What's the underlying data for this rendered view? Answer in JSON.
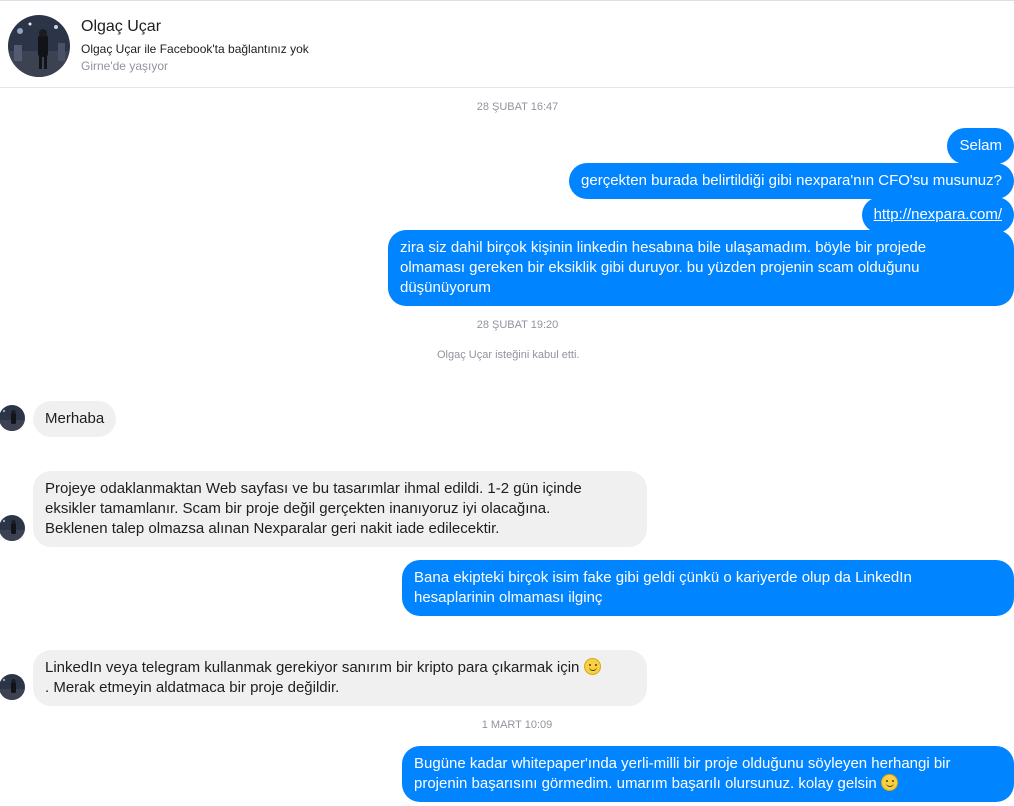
{
  "contact": {
    "name": "Olgaç Uçar",
    "connection": "Olgaç Uçar ile Facebook'ta bağlantınız yok",
    "location": "Girne'de yaşıyor"
  },
  "thread": {
    "stamp1": "28 ŞUBAT 16:47",
    "stamp2": "28 ŞUBAT 19:20",
    "stamp3": "1 MART 10:09",
    "system_accept": "Olgaç Uçar isteğini kabul etti.",
    "messages": [
      {
        "from": "me",
        "text": "Selam"
      },
      {
        "from": "me",
        "text": "gerçekten burada belirtildiği gibi nexpara'nın CFO'su musunuz?"
      },
      {
        "from": "me",
        "text": "http://nexpara.com/",
        "type": "link"
      },
      {
        "from": "me",
        "lines": [
          "zira siz dahil birçok kişinin linkedin hesabına bile ulaşamadım. böyle bir projede",
          "olmaması gereken bir eksiklik gibi duruyor. bu yüzden projenin scam olduğunu",
          "düşünüyorum"
        ]
      },
      {
        "from": "them",
        "text": "Merhaba"
      },
      {
        "from": "them",
        "lines": [
          "Projeye odaklanmaktan Web sayfası ve bu tasarımlar ihmal edildi. 1-2 gün içinde",
          "eksikler tamamlanır. Scam bir proje değil gerçekten inanıyoruz iyi olacağına.",
          "Beklenen talep olmazsa alınan Nexparalar geri nakit iade edilecektir."
        ]
      },
      {
        "from": "me",
        "lines": [
          "Bana ekipteki birçok isim fake gibi geldi çünkü o kariyerde olup da LinkedIn",
          "hesaplarinin olmaması ilginç"
        ]
      },
      {
        "from": "them",
        "lines": [
          "LinkedIn veya telegram kullanmak gerekiyor sanırım bir kripto para çıkarmak için",
          ". Merak etmeyin aldatmaca bir proje değildir."
        ],
        "emoji": "smile-emoji"
      },
      {
        "from": "me",
        "lines": [
          "Bugüne kadar whitepaper'ında yerli-milli bir proje olduğunu söyleyen herhangi bir",
          "projenin başarısını görmedim. umarım başarılı olursunuz. kolay gelsin"
        ],
        "emoji": "smile-emoji"
      }
    ]
  },
  "colors": {
    "outgoing": "#0084ff",
    "incoming": "#f1f0f0",
    "meta_text": "#90949c"
  }
}
